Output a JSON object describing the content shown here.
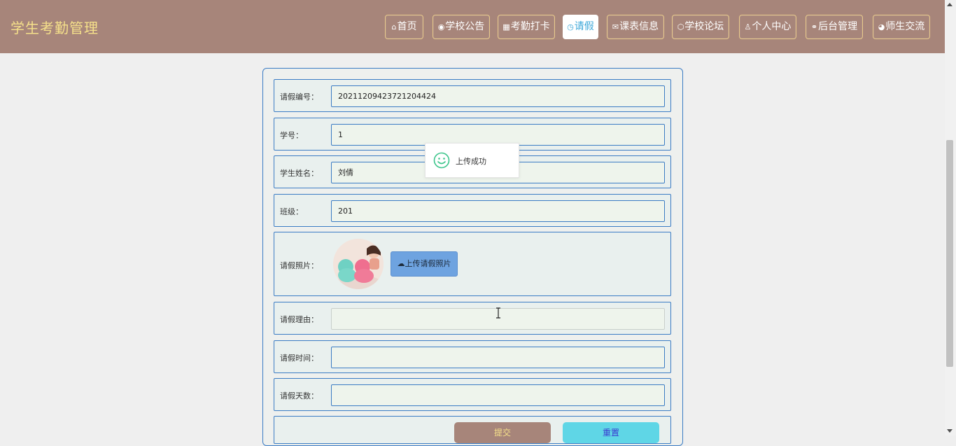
{
  "header": {
    "brand": "学生考勤管理",
    "nav": [
      {
        "label": "首页",
        "icon": "⌂"
      },
      {
        "label": "学校公告",
        "icon": "◉"
      },
      {
        "label": "考勤打卡",
        "icon": "▦"
      },
      {
        "label": "请假",
        "icon": "◷"
      },
      {
        "label": "课表信息",
        "icon": "✉"
      },
      {
        "label": "学校论坛",
        "icon": "⬡"
      },
      {
        "label": "个人中心",
        "icon": "♙"
      },
      {
        "label": "后台管理",
        "icon": "⚭"
      },
      {
        "label": "师生交流",
        "icon": "◕"
      }
    ],
    "active_nav": "请假"
  },
  "form": {
    "leave_no": {
      "label": "请假编号：",
      "value": "20211209423721204424"
    },
    "student_no": {
      "label": "学号：",
      "value": "1"
    },
    "student_name": {
      "label": "学生姓名：",
      "value": "刘倩"
    },
    "class": {
      "label": "班级：",
      "value": "201"
    },
    "photo": {
      "label": "请假照片：",
      "upload_label": "上传请假照片"
    },
    "reason": {
      "label": "请假理由：",
      "value": ""
    },
    "time": {
      "label": "请假时间：",
      "value": ""
    },
    "days": {
      "label": "请假天数：",
      "value": ""
    },
    "submit_label": "提交",
    "reset_label": "重置"
  },
  "toast": {
    "message": "上传成功"
  },
  "colors": {
    "header_bg": "#a7857a",
    "brand": "#f5e08a",
    "border": "#3b7cc4",
    "active_nav_text": "#3aa6d8",
    "reset_bg": "#5fd6e6",
    "toast_icon": "#3cc58b"
  }
}
